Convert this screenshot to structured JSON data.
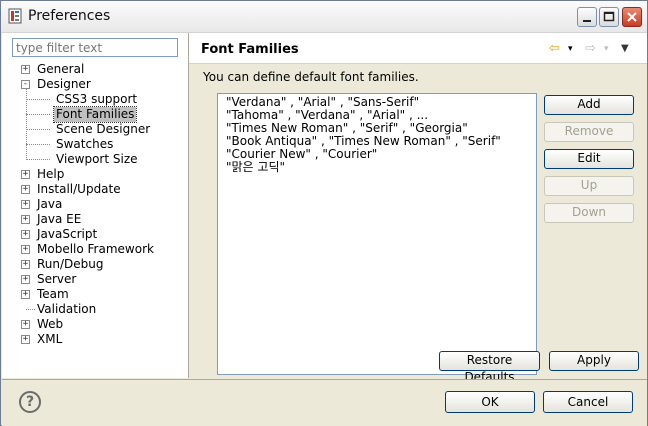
{
  "window": {
    "title": "Preferences"
  },
  "filter": {
    "placeholder": "type filter text"
  },
  "tree": [
    {
      "label": "General",
      "expander": "+",
      "level": 0
    },
    {
      "label": "Designer",
      "expander": "-",
      "level": 0
    },
    {
      "label": "CSS3 support",
      "expander": "",
      "level": 1
    },
    {
      "label": "Font Families",
      "expander": "",
      "level": 1,
      "selected": true
    },
    {
      "label": "Scene Designer",
      "expander": "",
      "level": 1
    },
    {
      "label": "Swatches",
      "expander": "",
      "level": 1
    },
    {
      "label": "Viewport Size",
      "expander": "",
      "level": 1
    },
    {
      "label": "Help",
      "expander": "+",
      "level": 0
    },
    {
      "label": "Install/Update",
      "expander": "+",
      "level": 0
    },
    {
      "label": "Java",
      "expander": "+",
      "level": 0
    },
    {
      "label": "Java EE",
      "expander": "+",
      "level": 0
    },
    {
      "label": "JavaScript",
      "expander": "+",
      "level": 0
    },
    {
      "label": "Mobello Framework",
      "expander": "+",
      "level": 0
    },
    {
      "label": "Run/Debug",
      "expander": "+",
      "level": 0
    },
    {
      "label": "Server",
      "expander": "+",
      "level": 0
    },
    {
      "label": "Team",
      "expander": "+",
      "level": 0
    },
    {
      "label": "Validation",
      "expander": "",
      "level": 0
    },
    {
      "label": "Web",
      "expander": "+",
      "level": 0
    },
    {
      "label": "XML",
      "expander": "+",
      "level": 0
    }
  ],
  "page": {
    "title": "Font Families",
    "description": "You can define default font families.",
    "back_arrow": "⇦",
    "forward_arrow": "⇨",
    "dropdown_glyph": "▾",
    "menu_glyph": "▼"
  },
  "font_families": [
    "\"Verdana\" , \"Arial\" , \"Sans-Serif\"",
    "\"Tahoma\" , \"Verdana\" , \"Arial\" , ...",
    "\"Times New Roman\" , \"Serif\" , \"Georgia\"",
    "\"Book Antiqua\" , \"Times New Roman\" , \"Serif\"",
    "\"Courier New\" , \"Courier\"",
    "\"맑은 고딕\""
  ],
  "side_buttons": {
    "add": "Add",
    "remove": "Remove",
    "edit": "Edit",
    "up": "Up",
    "down": "Down"
  },
  "restore_defaults": "Restore Defaults",
  "apply": "Apply",
  "ok": "OK",
  "cancel": "Cancel",
  "help_glyph": "?",
  "colors": {
    "accent_close": "#c83d24",
    "selection": "#c0c0c0"
  }
}
